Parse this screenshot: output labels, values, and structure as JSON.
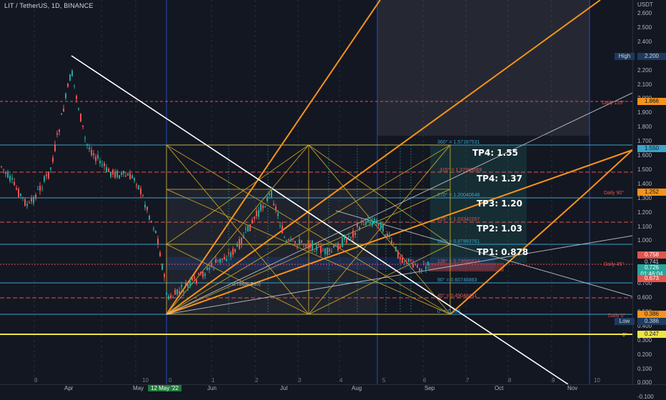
{
  "header": {
    "symbol_line": "LIT / TetherUS, 1D, BINANCE"
  },
  "axis": {
    "currency": "USDT",
    "y_ticks": [
      "2.600",
      "2.500",
      "2.400",
      "2.300",
      "2.200",
      "2.100",
      "2.000",
      "1.900",
      "1.800",
      "1.700",
      "1.600",
      "1.500",
      "1.400",
      "1.300",
      "1.200",
      "1.100",
      "1.000",
      "0.900",
      "0.800",
      "0.700",
      "0.600",
      "0.500",
      "0.400",
      "0.300",
      "0.200",
      "0.100",
      "0.000",
      "-0.100"
    ],
    "x_ticks": [
      "Apr",
      "May",
      "Jun",
      "Jul",
      "Aug",
      "Sep",
      "Oct",
      "Nov"
    ],
    "x_highlight": "12 May '22"
  },
  "badges": {
    "high_label": "High",
    "high_value": "2.200",
    "daily135_value": "1.866",
    "p1550": "1.550",
    "p1252": "1.252",
    "p0758": "0.758",
    "p0741": "0.741",
    "last_price": "0.726",
    "countdown": "01:46:04",
    "p0673": "0.673",
    "p0386": "0.386",
    "low_label": "Low",
    "low_value": "0.386",
    "p0247": "0.247"
  },
  "targets": {
    "tp4": "TP4: 1.55",
    "tp4b": "TP4: 1.37",
    "tp3": "TP3: 1.20",
    "tp2": "TP2: 1.03",
    "tp1": "TP1: 0.878"
  },
  "gann_labels": {
    "g360": "360° = 1.57187531",
    "g315": "315° = 1.37989969",
    "g270": "270° = 1.20040648",
    "g225": "225° = 1.03342207",
    "g180": "180° = 0.87893761",
    "g135": "135° = 0.73695824",
    "g90": "90° = 0.60746883",
    "g45": "45° = 0.49048441",
    "g0": "0° = 0.386",
    "fib": "0.786(0.590)",
    "daily135": "Daily 135°",
    "daily90": "Daily 90°",
    "daily45": "Daily 45°",
    "daily0": "Daily 0°",
    "zero": "0°"
  },
  "cycle_numbers": [
    "9",
    "10",
    "0",
    "1",
    "2",
    "3",
    "4",
    "5",
    "6",
    "7",
    "8",
    "9",
    "10"
  ],
  "colors": {
    "bg": "#131722",
    "up": "#26a69a",
    "down": "#ef5350",
    "gold": "#e8b923",
    "orange": "#f7931a",
    "cyan": "#3aa3c7",
    "red": "#e0554f",
    "yellow": "#f0e442",
    "blue": "#2962ff"
  }
}
